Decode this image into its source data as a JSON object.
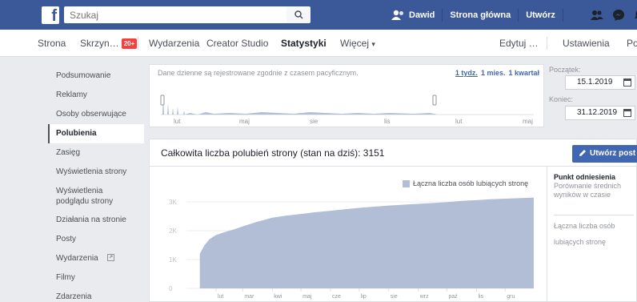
{
  "colors": {
    "brand": "#3b5998",
    "link": "#4267b2",
    "chart_fill": "#b2bed5",
    "badge": "#fa3e3e"
  },
  "topbar": {
    "logo": "f",
    "search_placeholder": "Szukaj",
    "search_icon": "search-icon",
    "user_name": "Dawid",
    "home": "Strona główna",
    "create": "Utwórz",
    "icons": [
      "friend-requests-icon",
      "messenger-icon",
      "notifications-icon",
      "help-icon"
    ]
  },
  "pagenav": {
    "tabs": [
      "Strona",
      "Skrzyn…",
      "Wydarzenia",
      "Creator Studio",
      "Statystyki",
      "Więcej"
    ],
    "inbox_badge": "20+",
    "more_caret": "▾",
    "edit": "Edytuj …",
    "settings": "Ustawienia",
    "help": "Pomoc"
  },
  "sidebar": {
    "items": [
      "Podsumowanie",
      "Reklamy",
      "Osoby obserwujące",
      "Polubienia",
      "Zasięg",
      "Wyświetlenia strony",
      "Wyświetlenia podglądu strony",
      "Działania na stronie",
      "Posty",
      "Wydarzenia",
      "Filmy",
      "Zdarzenia"
    ],
    "active": "Polubienia"
  },
  "timeline": {
    "note": "Dane dzienne są rejestrowane zgodnie z czasem pacyficznym.",
    "ranges": [
      "1 tydz.",
      "1 mies.",
      "1 kwartał"
    ],
    "months": [
      "lut",
      "maj",
      "sie",
      "lis",
      "lut",
      "maj"
    ]
  },
  "dates": {
    "start_label": "Początek:",
    "start_value": "15.1.2019",
    "end_label": "Koniec:",
    "end_value": "31.12.2019"
  },
  "main": {
    "title": "Całkowita liczba polubień strony (stan na dziś): 3151",
    "create_post": "Utwórz post"
  },
  "right_panel": {
    "title": "Punkt odniesienia",
    "subtitle": "Porównanie średnich wyników w czasie",
    "metric": "Łączna liczba osób lubiących stronę"
  },
  "chart_data": {
    "type": "area",
    "title": "Całkowita liczba polubień strony (stan na dziś): 3151",
    "legend": [
      "Łączna liczba osób lubiących stronę"
    ],
    "legend_position": "top-right",
    "x_ticks": [
      "lut",
      "mar",
      "kwi",
      "maj",
      "cze",
      "lip",
      "sie",
      "wrz",
      "paź",
      "lis",
      "gru"
    ],
    "x_year": "2019",
    "y_ticks": [
      "0",
      "1K",
      "2K",
      "3K"
    ],
    "ylim": [
      0,
      3500
    ],
    "grid": true,
    "series": [
      {
        "name": "Łączna liczba osób lubiących stronę",
        "x": [
          "2019-01-15",
          "2019-01-20",
          "2019-01-25",
          "2019-02-01",
          "2019-02-10",
          "2019-02-20",
          "2019-03-01",
          "2019-03-15",
          "2019-04-01",
          "2019-04-15",
          "2019-05-01",
          "2019-05-15",
          "2019-06-01",
          "2019-06-15",
          "2019-07-01",
          "2019-07-15",
          "2019-08-01",
          "2019-08-15",
          "2019-09-01",
          "2019-09-15",
          "2019-10-01",
          "2019-10-15",
          "2019-11-01",
          "2019-11-15",
          "2019-12-01",
          "2019-12-15",
          "2019-12-31"
        ],
        "values": [
          1200,
          1500,
          1700,
          1850,
          1950,
          2050,
          2150,
          2300,
          2450,
          2520,
          2580,
          2640,
          2690,
          2740,
          2790,
          2830,
          2870,
          2900,
          2930,
          2960,
          2990,
          3030,
          3060,
          3090,
          3110,
          3130,
          3151
        ]
      }
    ]
  }
}
